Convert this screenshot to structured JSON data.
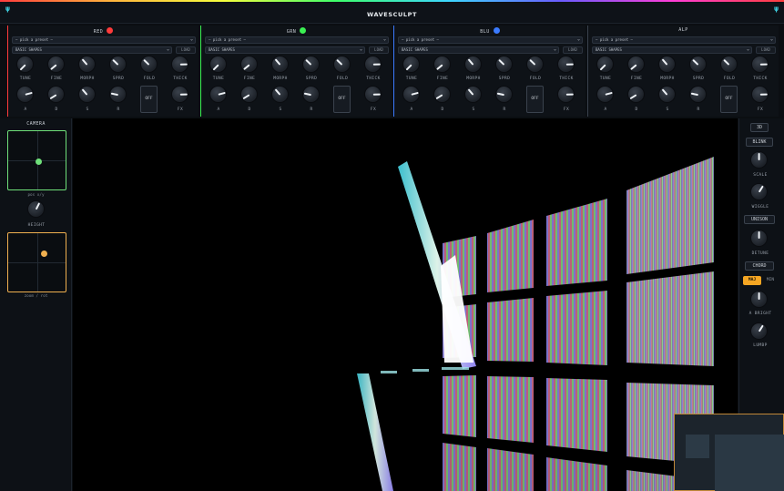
{
  "app": {
    "title": "WAVESCULPT",
    "left_icon": "ψ",
    "right_icon": "ψ"
  },
  "channels": [
    {
      "name": "RED",
      "color": "#ff3b3b",
      "preset": "— pick a preset —",
      "bank": "BASIC SHAPES",
      "load": "LOAD",
      "knobs_top": [
        {
          "label": "TUNE",
          "value": 0.0
        },
        {
          "label": "FINE",
          "value": 0.02
        },
        {
          "label": "MORPH",
          "value": 0.35
        },
        {
          "label": "SPRD",
          "value": 0.33
        },
        {
          "label": "FOLD",
          "value": 0.33
        },
        {
          "label": "THICK",
          "value": 0.83
        }
      ],
      "knobs_bottom": [
        {
          "label": "A",
          "value": 0.78
        },
        {
          "label": "D",
          "value": 0.05
        },
        {
          "label": "S",
          "value": 0.35
        },
        {
          "label": "R",
          "value": 0.21
        }
      ],
      "off_label": "OFF",
      "fx": {
        "label": "FX",
        "value": 0.83
      }
    },
    {
      "name": "GRN",
      "color": "#3bf052",
      "preset": "— pick a preset —",
      "bank": "BASIC SHAPES",
      "load": "LOAD",
      "knobs_top": [
        {
          "label": "TUNE",
          "value": 0.0
        },
        {
          "label": "FINE",
          "value": 0.02
        },
        {
          "label": "MORPH",
          "value": 0.35
        },
        {
          "label": "SPRD",
          "value": 0.33
        },
        {
          "label": "FOLD",
          "value": 0.33
        },
        {
          "label": "THICK",
          "value": 0.83
        }
      ],
      "knobs_bottom": [
        {
          "label": "A",
          "value": 0.78
        },
        {
          "label": "D",
          "value": 0.05
        },
        {
          "label": "S",
          "value": 0.35
        },
        {
          "label": "R",
          "value": 0.21
        }
      ],
      "off_label": "OFF",
      "fx": {
        "label": "FX",
        "value": 0.83
      }
    },
    {
      "name": "BLU",
      "color": "#3b7bff",
      "preset": "— pick a preset —",
      "bank": "BASIC SHAPES",
      "load": "LOAD",
      "knobs_top": [
        {
          "label": "TUNE",
          "value": 0.0
        },
        {
          "label": "FINE",
          "value": 0.02
        },
        {
          "label": "MORPH",
          "value": 0.35
        },
        {
          "label": "SPRD",
          "value": 0.33
        },
        {
          "label": "FOLD",
          "value": 0.33
        },
        {
          "label": "THICK",
          "value": 0.83
        }
      ],
      "knobs_bottom": [
        {
          "label": "A",
          "value": 0.78
        },
        {
          "label": "D",
          "value": 0.05
        },
        {
          "label": "S",
          "value": 0.35
        },
        {
          "label": "R",
          "value": 0.21
        }
      ],
      "off_label": "OFF",
      "fx": {
        "label": "FX",
        "value": 0.83
      }
    },
    {
      "name": "ALP",
      "color": "",
      "preset": "— pick a preset —",
      "bank": "BASIC SHAPES",
      "load": "LOAD",
      "knobs_top": [
        {
          "label": "TUNE",
          "value": 0.0
        },
        {
          "label": "FINE",
          "value": 0.02
        },
        {
          "label": "MORPH",
          "value": 0.35
        },
        {
          "label": "SPRD",
          "value": 0.33
        },
        {
          "label": "FOLD",
          "value": 0.33
        },
        {
          "label": "THICK",
          "value": 0.83
        }
      ],
      "knobs_bottom": [
        {
          "label": "A",
          "value": 0.78
        },
        {
          "label": "D",
          "value": 0.05
        },
        {
          "label": "S",
          "value": 0.35
        },
        {
          "label": "R",
          "value": 0.21
        }
      ],
      "off_label": "OFF",
      "fx": {
        "label": "FX",
        "value": 0.83
      }
    }
  ],
  "camera": {
    "title": "CAMERA",
    "pos_caption": "pos x/y",
    "height_label": "HEIGHT",
    "height_value": 0.6,
    "orbit_caption": "zoom / rot",
    "pos_pad_color": "#6fe07a",
    "orbit_pad_color": "#f0b050"
  },
  "right_panel": {
    "mode_3d": "3D",
    "blink": "BLINK",
    "scale_label": "SCALE",
    "scale_value": 0.5,
    "wiggle_label": "WIGGLE",
    "wiggle_value": 0.62,
    "unison": "UNISON",
    "detune_label": "DETUNE",
    "detune_value": 0.5,
    "chord": "CHORD",
    "maj": "MAJ",
    "min": "MIN",
    "a_bright_label": "A BRIGHT",
    "a_bright_value": 0.5,
    "lumbp_label": "LUMBP",
    "lumbp_value": 0.62,
    "accent": "#f5a623"
  }
}
